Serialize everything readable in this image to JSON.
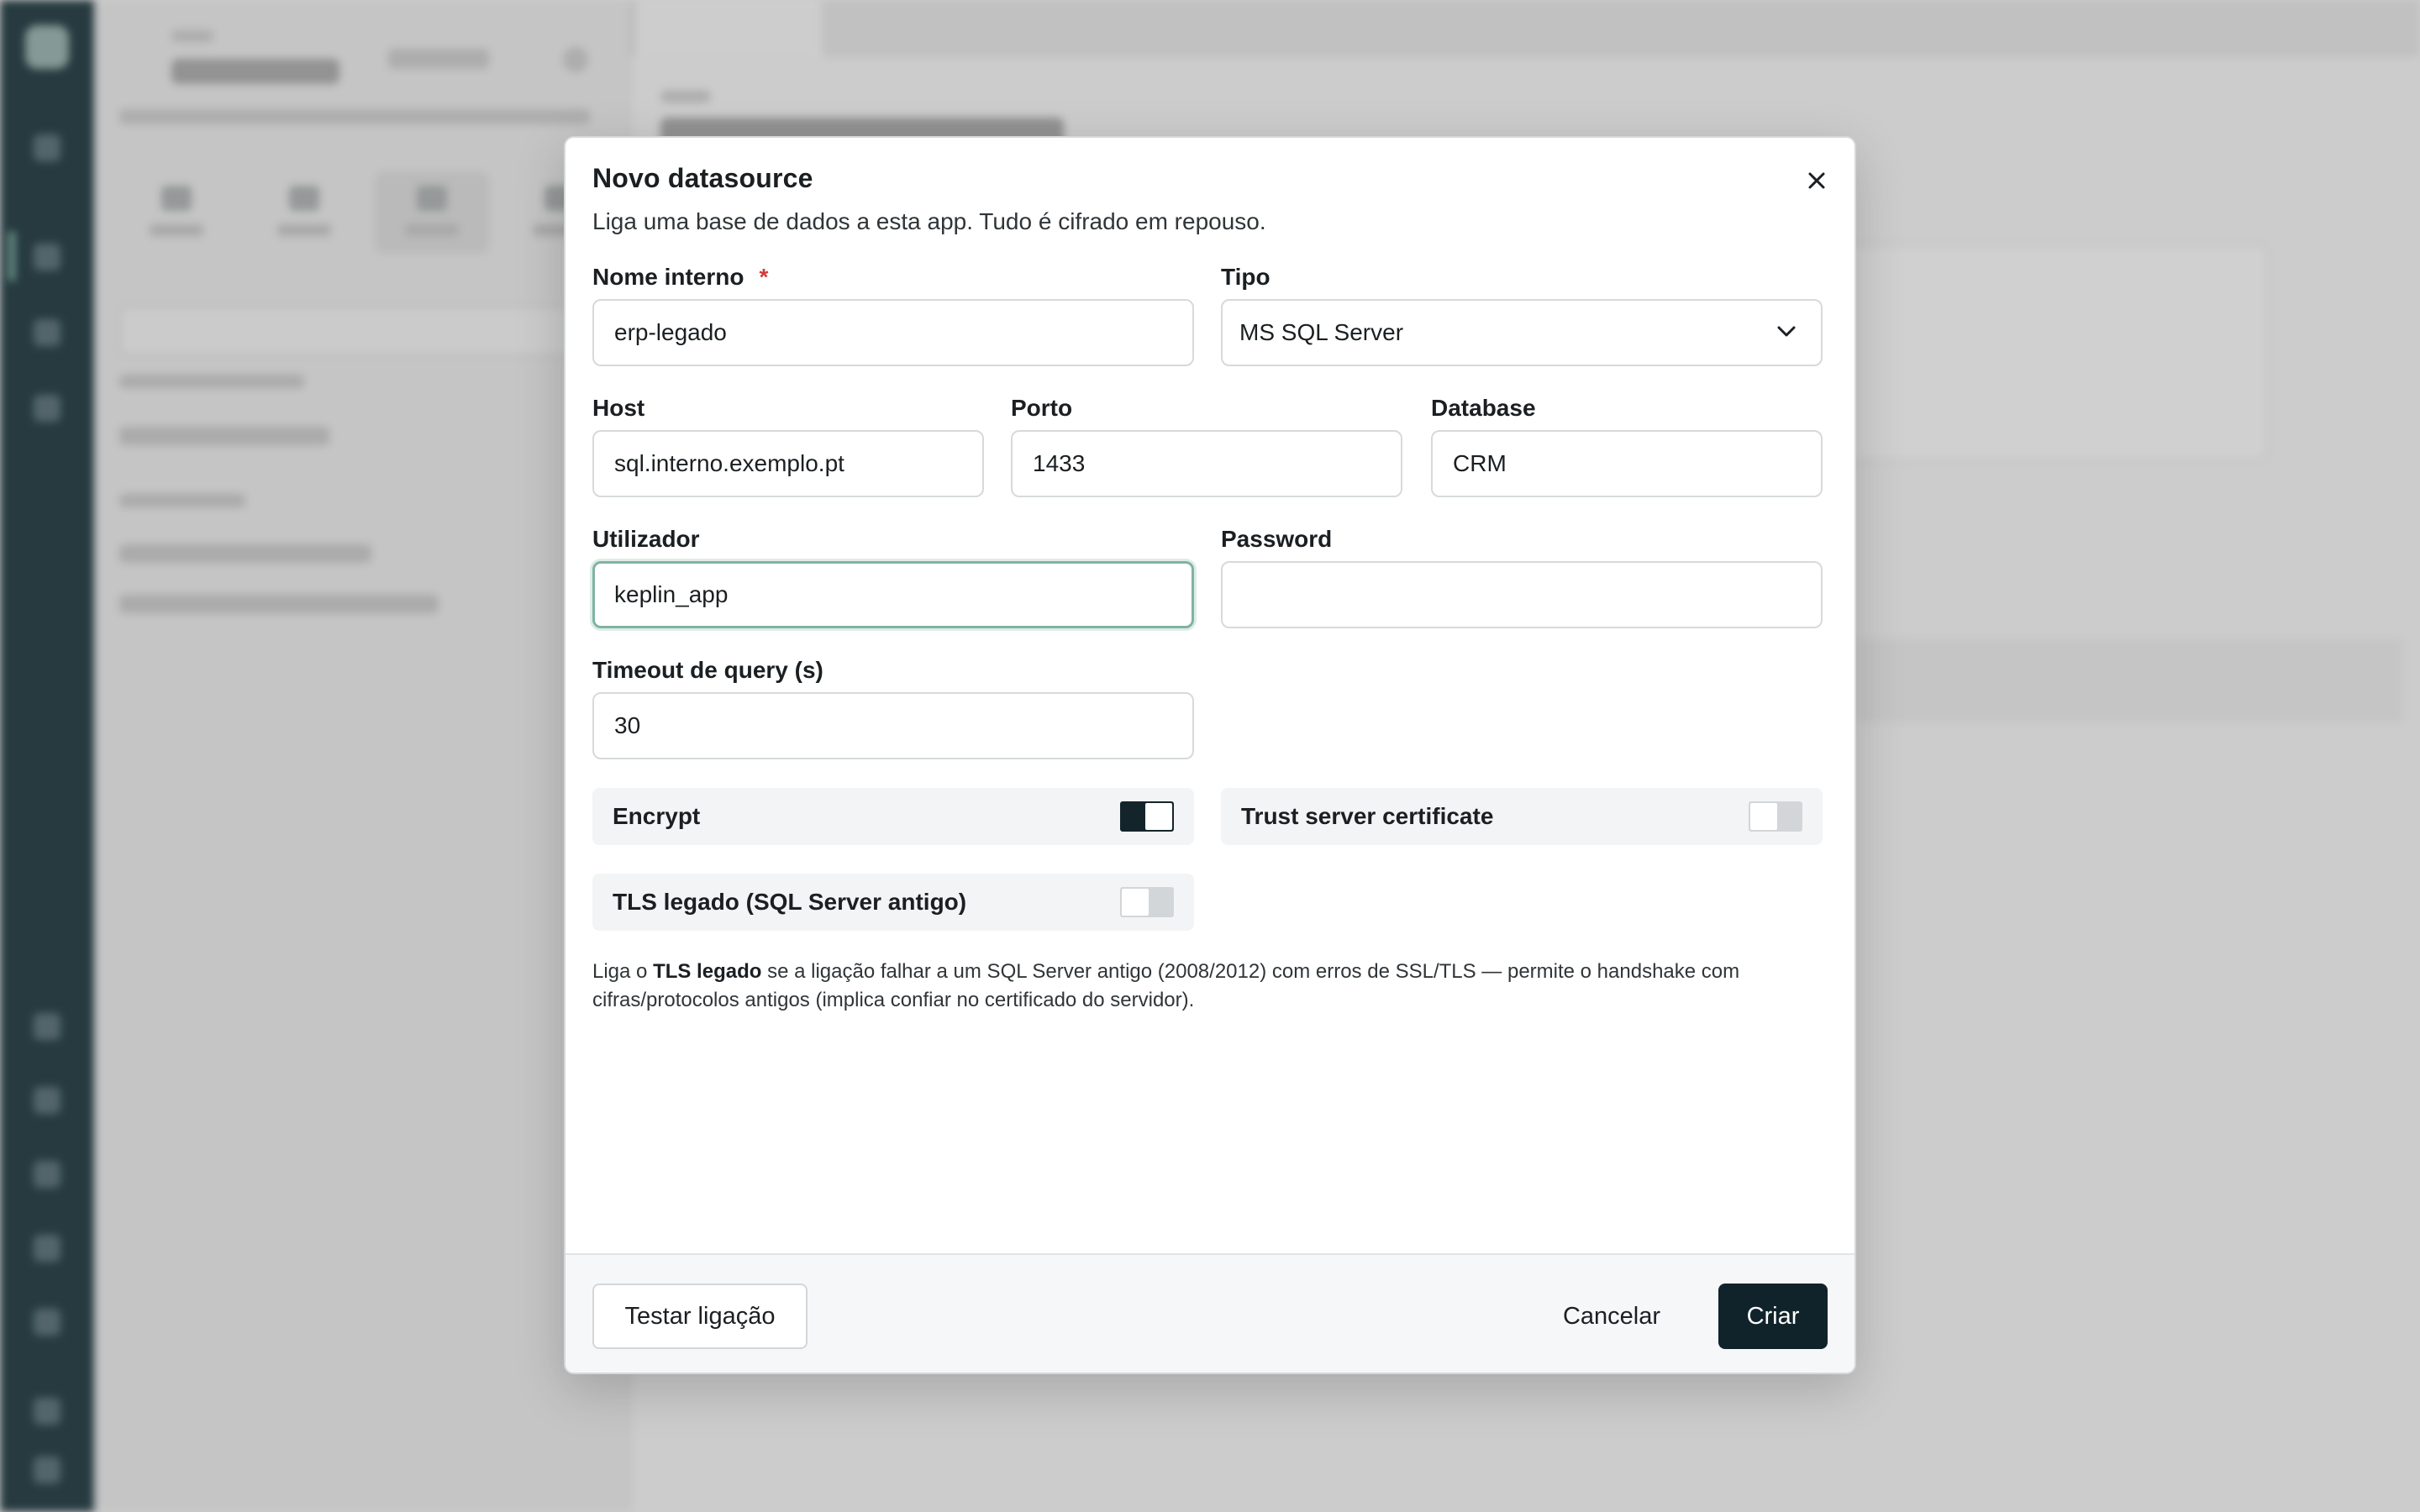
{
  "modal": {
    "title": "Novo datasource",
    "subtitle": "Liga uma base de dados a esta app. Tudo é cifrado em repouso.",
    "fields": {
      "internal_name": {
        "label": "Nome interno",
        "required_mark": "*",
        "value": "erp-legado"
      },
      "type": {
        "label": "Tipo",
        "value": "MS SQL Server"
      },
      "host": {
        "label": "Host",
        "value": "sql.interno.exemplo.pt"
      },
      "port": {
        "label": "Porto",
        "value": "1433"
      },
      "database": {
        "label": "Database",
        "value": "CRM"
      },
      "user": {
        "label": "Utilizador",
        "value": "keplin_app"
      },
      "password": {
        "label": "Password",
        "value": ""
      },
      "timeout": {
        "label": "Timeout de query (s)",
        "value": "30"
      }
    },
    "toggles": {
      "encrypt": {
        "label": "Encrypt",
        "on": true
      },
      "trust_cert": {
        "label": "Trust server certificate",
        "on": false
      },
      "tls_legacy": {
        "label": "TLS legado (SQL Server antigo)",
        "on": false
      }
    },
    "help": {
      "prefix": "Liga o ",
      "bold": "TLS legado",
      "suffix": " se a ligação falhar a um SQL Server antigo (2008/2012) com erros de SSL/TLS — permite o handshake com cifras/protocolos antigos (implica confiar no certificado do servidor)."
    },
    "footer": {
      "test_label": "Testar ligação",
      "cancel_label": "Cancelar",
      "create_label": "Criar"
    }
  },
  "colors": {
    "primary": "#11232a",
    "focus_ring": "#7fb3a4",
    "required": "#d43a3a",
    "rail": "#102a31"
  },
  "icons": {
    "close": "close-icon",
    "select": "chevron-down-icon"
  }
}
